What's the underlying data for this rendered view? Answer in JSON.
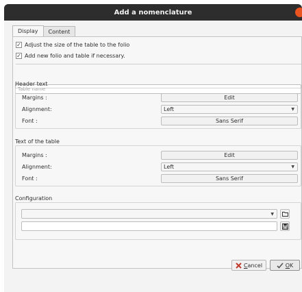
{
  "window": {
    "title": "Add a nomenclature"
  },
  "tabs": [
    {
      "label": "Display"
    },
    {
      "label": "Content"
    }
  ],
  "options": {
    "adjust_size": {
      "label": "Adjust the size of the table to the folio",
      "checked": true
    },
    "add_folio": {
      "label": "Add new folio and table if necessary.",
      "checked": true
    }
  },
  "table_name": {
    "placeholder": "Table name",
    "value": ""
  },
  "header_text": {
    "title": "Header text",
    "margins_label": "Margins :",
    "margins_button": "Edit",
    "alignment_label": "Alignment:",
    "alignment_value": "Left",
    "font_label": "Font :",
    "font_button": "Sans Serif"
  },
  "table_text": {
    "title": "Text of the table",
    "margins_label": "Margins :",
    "margins_button": "Edit",
    "alignment_label": "Alignment:",
    "alignment_value": "Left",
    "font_label": "Font :",
    "font_button": "Sans Serif"
  },
  "configuration": {
    "title": "Configuration"
  },
  "footer": {
    "cancel_prefix": "",
    "cancel_u": "C",
    "cancel_rest": "ancel",
    "ok_u": "O",
    "ok_rest": "K"
  },
  "colors": {
    "titlebar": "#2d2d2d",
    "close": "#e95420",
    "cancel_icon": "#c0392b"
  }
}
